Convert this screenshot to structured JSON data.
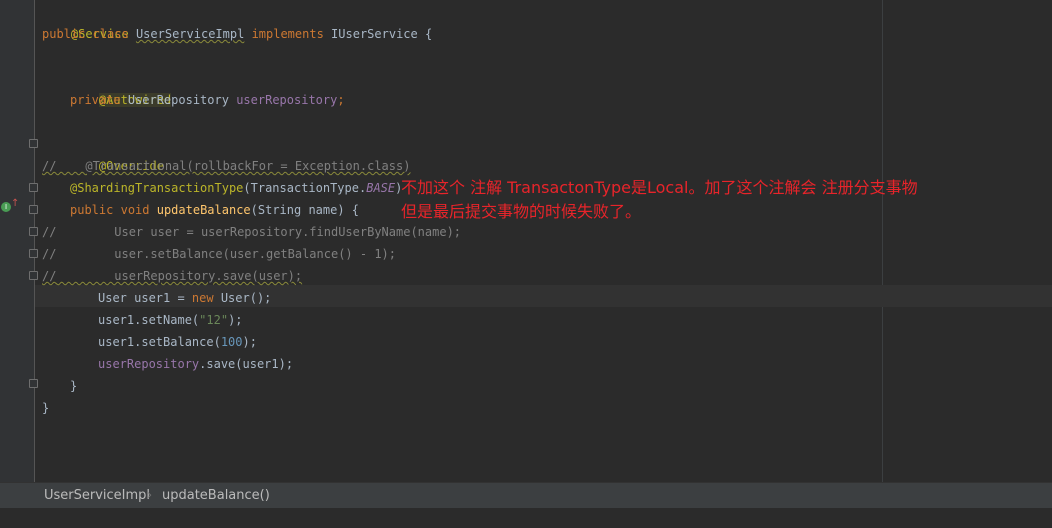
{
  "code": {
    "l1": {
      "annotation": "@Service"
    },
    "l2": {
      "kw1": "public",
      "kw2": "class",
      "name": "UserServiceImpl",
      "kw3": "implements",
      "iface": "IUserService {"
    },
    "l4": {
      "annotation": "@Autowired"
    },
    "l5": {
      "kw": "private",
      "type": "UserRepository",
      "field": "userRepository",
      "semi": ";"
    },
    "l7": {
      "annotation": "@Override"
    },
    "l8": {
      "text": "//    @Transactional(rollbackFor = Exception.class)"
    },
    "l9": {
      "annotation": "@ShardingTransactionType",
      "paren": "(TransactionType.",
      "const": "BASE",
      "close": ")"
    },
    "l10": {
      "kw1": "public",
      "kw2": "void",
      "method": "updateBalance",
      "rest": "(String name) {"
    },
    "l11": {
      "text": "//        User user = userRepository.findUserByName(name);"
    },
    "l12": {
      "text": "//        user.setBalance(user.getBalance() - 1);"
    },
    "l13": {
      "slashes": "//",
      "text": "        userRepository.save(user);"
    },
    "l14": {
      "a": "User user1 = ",
      "kw": "new",
      "b": " User();"
    },
    "l15": {
      "a": "user1.setName(",
      "str": "\"12\"",
      "b": ");"
    },
    "l16": {
      "a": "user1.setBalance(",
      "num": "100",
      "b": ");"
    },
    "l17": {
      "field": "userRepository",
      "rest": ".save(user1);"
    },
    "l18": {
      "text": "}"
    },
    "l19": {
      "text": "}"
    }
  },
  "gutter": {
    "run_marker": "I",
    "override_arrow": "↑"
  },
  "note": {
    "line1": "不加这个 注解 TransactonType是Local。加了这个注解会 注册分支事物",
    "line2": "但是最后提交事物的时候失败了。"
  },
  "breadcrumb": {
    "class_name": "UserServiceImpl",
    "separator": "›",
    "method_name": "updateBalance()"
  },
  "colors": {
    "background": "#2b2b2b",
    "keyword": "#cc7832",
    "annotation": "#bbb529",
    "field": "#9876aa",
    "method": "#ffc66d",
    "number": "#6897bb",
    "string": "#6a8759",
    "comment": "#808080",
    "note_red": "#e8242a"
  }
}
